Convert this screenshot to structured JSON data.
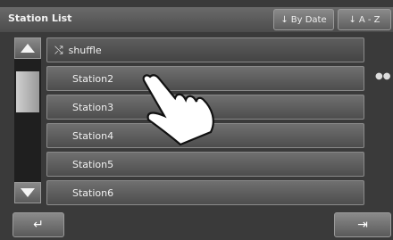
{
  "header": {
    "title": "Station List",
    "sort_by_date": "By Date",
    "sort_az": "A - Z",
    "sort_icon": "down-arrow-icon"
  },
  "list": {
    "shuffle_label": "shuffle",
    "items": [
      {
        "label": "Station2"
      },
      {
        "label": "Station3"
      },
      {
        "label": "Station4"
      },
      {
        "label": "Station5"
      },
      {
        "label": "Station6"
      }
    ]
  },
  "scrollbar": {
    "up_icon": "triangle-up-icon",
    "down_icon": "triangle-down-icon"
  },
  "footer": {
    "back_icon": "return-arrow-icon",
    "exit_icon": "exit-icon"
  },
  "colors": {
    "background": "#3a3a3a",
    "row": "#5e5e5e",
    "text": "#f0f0f0"
  }
}
